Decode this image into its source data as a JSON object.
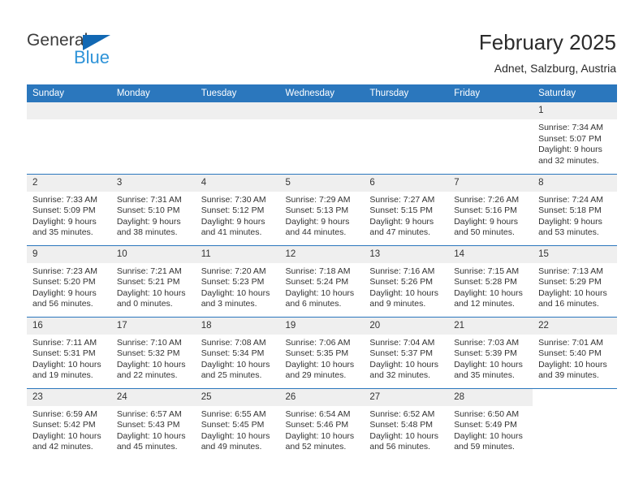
{
  "brand": {
    "name_part1": "General",
    "name_part2": "Blue",
    "color_dark": "#3b3b3b",
    "color_blue": "#2e93d8",
    "triangle_color": "#1268b3"
  },
  "header": {
    "month_title": "February 2025",
    "location": "Adnet, Salzburg, Austria"
  },
  "calendar": {
    "accent_color": "#2b77bd",
    "daynum_band_color": "#efefef",
    "weekday_headers": [
      "Sunday",
      "Monday",
      "Tuesday",
      "Wednesday",
      "Thursday",
      "Friday",
      "Saturday"
    ],
    "weeks": [
      [
        {
          "day": "",
          "lines": []
        },
        {
          "day": "",
          "lines": []
        },
        {
          "day": "",
          "lines": []
        },
        {
          "day": "",
          "lines": []
        },
        {
          "day": "",
          "lines": []
        },
        {
          "day": "",
          "lines": []
        },
        {
          "day": "1",
          "lines": [
            "Sunrise: 7:34 AM",
            "Sunset: 5:07 PM",
            "Daylight: 9 hours",
            "and 32 minutes."
          ]
        }
      ],
      [
        {
          "day": "2",
          "lines": [
            "Sunrise: 7:33 AM",
            "Sunset: 5:09 PM",
            "Daylight: 9 hours",
            "and 35 minutes."
          ]
        },
        {
          "day": "3",
          "lines": [
            "Sunrise: 7:31 AM",
            "Sunset: 5:10 PM",
            "Daylight: 9 hours",
            "and 38 minutes."
          ]
        },
        {
          "day": "4",
          "lines": [
            "Sunrise: 7:30 AM",
            "Sunset: 5:12 PM",
            "Daylight: 9 hours",
            "and 41 minutes."
          ]
        },
        {
          "day": "5",
          "lines": [
            "Sunrise: 7:29 AM",
            "Sunset: 5:13 PM",
            "Daylight: 9 hours",
            "and 44 minutes."
          ]
        },
        {
          "day": "6",
          "lines": [
            "Sunrise: 7:27 AM",
            "Sunset: 5:15 PM",
            "Daylight: 9 hours",
            "and 47 minutes."
          ]
        },
        {
          "day": "7",
          "lines": [
            "Sunrise: 7:26 AM",
            "Sunset: 5:16 PM",
            "Daylight: 9 hours",
            "and 50 minutes."
          ]
        },
        {
          "day": "8",
          "lines": [
            "Sunrise: 7:24 AM",
            "Sunset: 5:18 PM",
            "Daylight: 9 hours",
            "and 53 minutes."
          ]
        }
      ],
      [
        {
          "day": "9",
          "lines": [
            "Sunrise: 7:23 AM",
            "Sunset: 5:20 PM",
            "Daylight: 9 hours",
            "and 56 minutes."
          ]
        },
        {
          "day": "10",
          "lines": [
            "Sunrise: 7:21 AM",
            "Sunset: 5:21 PM",
            "Daylight: 10 hours",
            "and 0 minutes."
          ]
        },
        {
          "day": "11",
          "lines": [
            "Sunrise: 7:20 AM",
            "Sunset: 5:23 PM",
            "Daylight: 10 hours",
            "and 3 minutes."
          ]
        },
        {
          "day": "12",
          "lines": [
            "Sunrise: 7:18 AM",
            "Sunset: 5:24 PM",
            "Daylight: 10 hours",
            "and 6 minutes."
          ]
        },
        {
          "day": "13",
          "lines": [
            "Sunrise: 7:16 AM",
            "Sunset: 5:26 PM",
            "Daylight: 10 hours",
            "and 9 minutes."
          ]
        },
        {
          "day": "14",
          "lines": [
            "Sunrise: 7:15 AM",
            "Sunset: 5:28 PM",
            "Daylight: 10 hours",
            "and 12 minutes."
          ]
        },
        {
          "day": "15",
          "lines": [
            "Sunrise: 7:13 AM",
            "Sunset: 5:29 PM",
            "Daylight: 10 hours",
            "and 16 minutes."
          ]
        }
      ],
      [
        {
          "day": "16",
          "lines": [
            "Sunrise: 7:11 AM",
            "Sunset: 5:31 PM",
            "Daylight: 10 hours",
            "and 19 minutes."
          ]
        },
        {
          "day": "17",
          "lines": [
            "Sunrise: 7:10 AM",
            "Sunset: 5:32 PM",
            "Daylight: 10 hours",
            "and 22 minutes."
          ]
        },
        {
          "day": "18",
          "lines": [
            "Sunrise: 7:08 AM",
            "Sunset: 5:34 PM",
            "Daylight: 10 hours",
            "and 25 minutes."
          ]
        },
        {
          "day": "19",
          "lines": [
            "Sunrise: 7:06 AM",
            "Sunset: 5:35 PM",
            "Daylight: 10 hours",
            "and 29 minutes."
          ]
        },
        {
          "day": "20",
          "lines": [
            "Sunrise: 7:04 AM",
            "Sunset: 5:37 PM",
            "Daylight: 10 hours",
            "and 32 minutes."
          ]
        },
        {
          "day": "21",
          "lines": [
            "Sunrise: 7:03 AM",
            "Sunset: 5:39 PM",
            "Daylight: 10 hours",
            "and 35 minutes."
          ]
        },
        {
          "day": "22",
          "lines": [
            "Sunrise: 7:01 AM",
            "Sunset: 5:40 PM",
            "Daylight: 10 hours",
            "and 39 minutes."
          ]
        }
      ],
      [
        {
          "day": "23",
          "lines": [
            "Sunrise: 6:59 AM",
            "Sunset: 5:42 PM",
            "Daylight: 10 hours",
            "and 42 minutes."
          ]
        },
        {
          "day": "24",
          "lines": [
            "Sunrise: 6:57 AM",
            "Sunset: 5:43 PM",
            "Daylight: 10 hours",
            "and 45 minutes."
          ]
        },
        {
          "day": "25",
          "lines": [
            "Sunrise: 6:55 AM",
            "Sunset: 5:45 PM",
            "Daylight: 10 hours",
            "and 49 minutes."
          ]
        },
        {
          "day": "26",
          "lines": [
            "Sunrise: 6:54 AM",
            "Sunset: 5:46 PM",
            "Daylight: 10 hours",
            "and 52 minutes."
          ]
        },
        {
          "day": "27",
          "lines": [
            "Sunrise: 6:52 AM",
            "Sunset: 5:48 PM",
            "Daylight: 10 hours",
            "and 56 minutes."
          ]
        },
        {
          "day": "28",
          "lines": [
            "Sunrise: 6:50 AM",
            "Sunset: 5:49 PM",
            "Daylight: 10 hours",
            "and 59 minutes."
          ]
        },
        {
          "day": "",
          "lines": []
        }
      ]
    ]
  }
}
